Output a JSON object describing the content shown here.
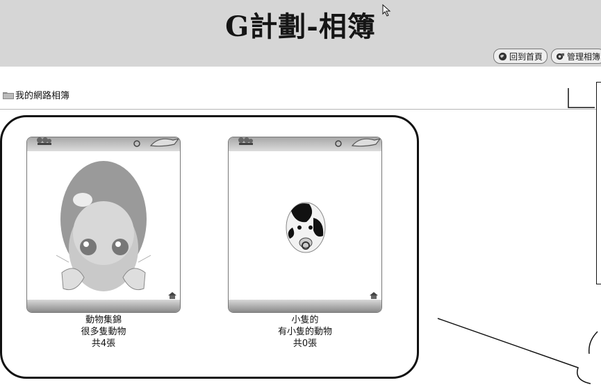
{
  "header": {
    "title": "G計劃-相簿",
    "nav": [
      {
        "label": "回到首頁",
        "icon": "home-globe-icon"
      },
      {
        "label": "管理相簿",
        "icon": "manage-gear-icon"
      }
    ]
  },
  "breadcrumb": {
    "icon": "folder-icon",
    "label": "我的網路相簿"
  },
  "albums": [
    {
      "name": "動物集錦",
      "description": "很多隻動物",
      "count_label": "共4張",
      "cover": "hermit-crab-image"
    },
    {
      "name": "小隻的",
      "description": "有小隻的動物",
      "count_label": "共0張",
      "cover": "cow-image"
    }
  ],
  "colors": {
    "header_bg": "#d6d6d6",
    "frame": "#777777",
    "annotation": "#111111"
  }
}
